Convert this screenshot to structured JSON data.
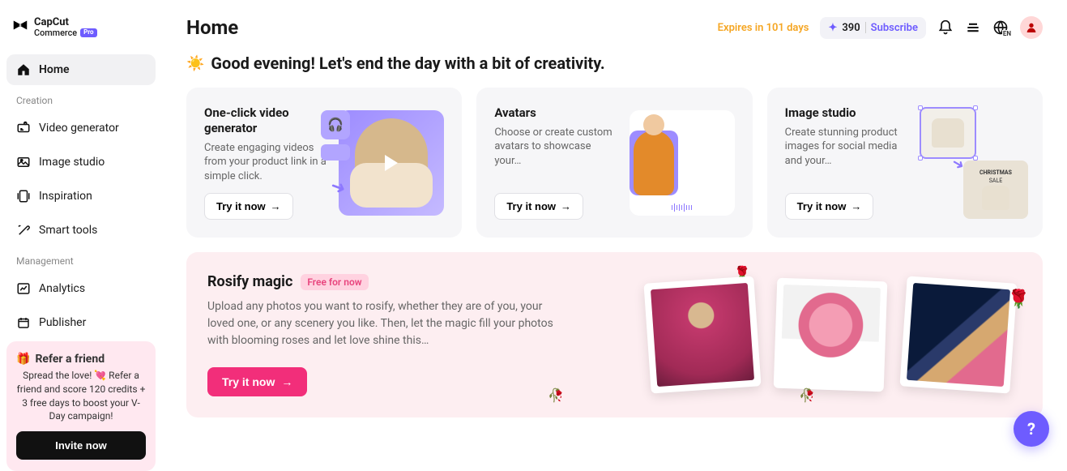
{
  "brand": {
    "name": "CapCut",
    "subline": "Commerce",
    "badge": "Pro"
  },
  "sidebar": {
    "home": "Home",
    "section_creation": "Creation",
    "items_creation": [
      {
        "label": "Video generator"
      },
      {
        "label": "Image studio"
      },
      {
        "label": "Inspiration"
      },
      {
        "label": "Smart tools"
      }
    ],
    "section_management": "Management",
    "items_management": [
      {
        "label": "Analytics"
      },
      {
        "label": "Publisher"
      }
    ]
  },
  "refer": {
    "title": "Refer a friend",
    "desc": "Spread the love! 💘 Refer a friend and score 120 credits + 3 free days to boost your V-Day campaign!",
    "button": "Invite now"
  },
  "topbar": {
    "title": "Home",
    "expires": "Expires in 101 days",
    "credits": "390",
    "subscribe": "Subscribe"
  },
  "greeting": "Good evening! Let's end the day with a bit of creativity.",
  "features": [
    {
      "title": "One-click video generator",
      "desc": "Create engaging videos from your product link in a simple click.",
      "cta": "Try it now"
    },
    {
      "title": "Avatars",
      "desc": "Choose or create custom avatars to showcase your…",
      "cta": "Try it now"
    },
    {
      "title": "Image studio",
      "desc": "Create stunning product images for social media and your…",
      "cta": "Try it now"
    }
  ],
  "rosify": {
    "title": "Rosify magic",
    "badge": "Free for now",
    "desc": "Upload any photos you want to rosify, whether they are of you, your loved one, or any scenery you like. Then, let the magic fill your photos with blooming roses and let love shine this…",
    "cta": "Try it now"
  },
  "lang_badge": "EN"
}
